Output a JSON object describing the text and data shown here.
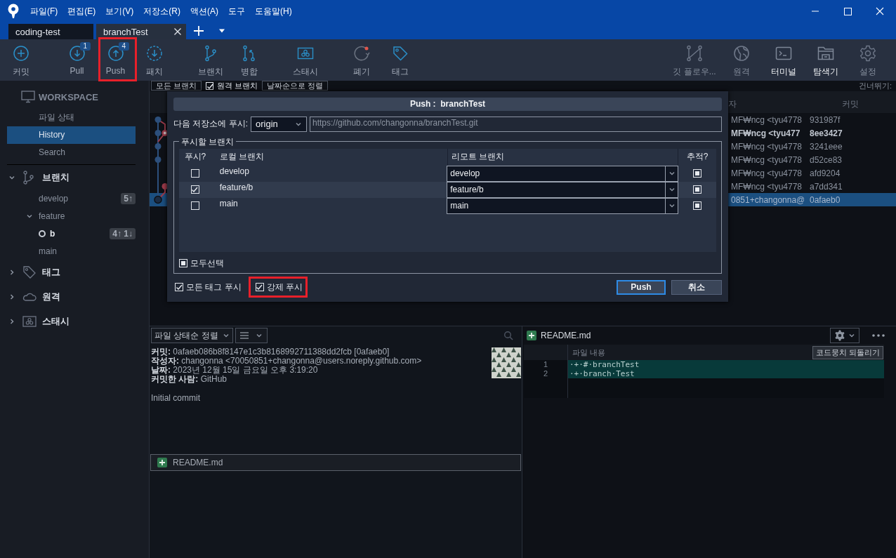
{
  "window": {
    "menu": [
      "파일(F)",
      "편집(E)",
      "보기(V)",
      "저장소(R)",
      "액션(A)",
      "도구",
      "도움말(H)"
    ]
  },
  "tabs": [
    {
      "label": "coding-test",
      "selected": false
    },
    {
      "label": "branchTest",
      "selected": true
    }
  ],
  "toolbar": {
    "left_groups": [
      [
        {
          "label": "커밋",
          "highlighted": false
        }
      ],
      [
        {
          "label": "Pull",
          "badge": "1",
          "highlighted": false
        },
        {
          "label": "Push",
          "badge": "4",
          "highlighted": true
        },
        {
          "label": "패치",
          "highlighted": false
        }
      ],
      [
        {
          "label": "브랜치",
          "highlighted": false
        },
        {
          "label": "병합",
          "highlighted": false
        }
      ],
      [
        {
          "label": "스태시",
          "highlighted": false
        }
      ],
      [
        {
          "label": "폐기",
          "highlighted": false
        },
        {
          "label": "태그",
          "highlighted": false
        }
      ]
    ],
    "right": [
      {
        "label": "깃 플로우...",
        "active": false
      },
      {
        "label": "원격",
        "active": false
      },
      {
        "label": "터미널",
        "active": true
      },
      {
        "label": "탐색기",
        "active": true
      },
      {
        "label": "설정",
        "active": false
      }
    ]
  },
  "sidebar": {
    "workspace": {
      "title": "WORKSPACE",
      "items": [
        {
          "label": "파일 상태",
          "selected": false
        },
        {
          "label": "History",
          "selected": true
        },
        {
          "label": "Search",
          "selected": false
        }
      ]
    },
    "sections": [
      {
        "title": "브랜치",
        "expanded": true,
        "children": [
          {
            "label": "develop",
            "badge": "5↑",
            "current": false
          },
          {
            "label": "feature",
            "expanded": true,
            "current": false,
            "children": [
              {
                "label": "b",
                "badge": "4↑ 1↓",
                "current": true
              }
            ]
          },
          {
            "label": "main",
            "current": false
          }
        ]
      },
      {
        "title": "태그",
        "expanded": false
      },
      {
        "title": "원격",
        "expanded": false
      },
      {
        "title": "스태시",
        "expanded": false
      }
    ]
  },
  "history": {
    "filters": {
      "branches": "모든 브랜치",
      "remote_branches": {
        "label": "원격 브랜치",
        "checked": true
      },
      "sort": "날짜순으로 정렬",
      "jump_label": "건너뛰기:"
    },
    "columns": [
      "자",
      "커밋"
    ],
    "rows": [
      {
        "author": "MF₩ncg <tyu4778",
        "commit": "931987f",
        "bold": false,
        "selected": false
      },
      {
        "author": "MF₩ncg <tyu477",
        "commit": "8ee3427",
        "bold": true,
        "selected": false
      },
      {
        "author": "MF₩ncg <tyu4778",
        "commit": "3241eee",
        "bold": false,
        "selected": false
      },
      {
        "author": "MF₩ncg <tyu4778",
        "commit": "d52ce83",
        "bold": false,
        "selected": false
      },
      {
        "author": "MF₩ncg <tyu4778",
        "commit": "afd9204",
        "bold": false,
        "selected": false
      },
      {
        "author": "MF₩ncg <tyu4778",
        "commit": "a7dd341",
        "bold": false,
        "selected": false
      },
      {
        "author": "0851+changonna@",
        "commit": "0afaeb0",
        "bold": false,
        "selected": true
      }
    ]
  },
  "push_dialog": {
    "title": "Push :  branchTest",
    "remote_label": "다음 저장소에 푸시:",
    "remote": "origin",
    "url": "https://github.com/changonna/branchTest.git",
    "group_title": "푸시할 브랜치",
    "columns": [
      "푸시?",
      "로컬 브랜치",
      "리모트 브랜치",
      "추적?"
    ],
    "branches": [
      {
        "push": false,
        "local": "develop",
        "remote": "develop",
        "track": true
      },
      {
        "push": true,
        "local": "feature/b",
        "remote": "feature/b",
        "track": true
      },
      {
        "push": false,
        "local": "main",
        "remote": "main",
        "track": true
      }
    ],
    "select_all": {
      "label": "모두선택",
      "indeterminate": true
    },
    "options": [
      {
        "label": "모든 태그 푸시",
        "checked": true,
        "highlighted": false
      },
      {
        "label": "강제 푸시",
        "checked": true,
        "highlighted": true
      }
    ],
    "buttons": [
      {
        "label": "Push",
        "default": true
      },
      {
        "label": "취소",
        "default": false
      }
    ]
  },
  "commit_details": {
    "sort": "파일 상태순 정렬",
    "lines": [
      "**커밋:** 0afaeb086b8f8147e1c3b8168992711388dd2fcb [0afaeb0]",
      "**작성자:** changonna <70050851+changonna@users.noreply.github.com>",
      "**날짜:** 2023년 12월 15일 금요일 오후 3:19:20",
      "**커밋한 사람:** GitHub"
    ],
    "message": "Initial commit",
    "files": [
      {
        "name": "README.md",
        "added": true
      }
    ]
  },
  "diff": {
    "file": {
      "name": "README.md",
      "added": true
    },
    "header": "파일 내용",
    "revert_button": "코드뭉치 되돌리기",
    "lines": [
      {
        "number": "1",
        "text": "·+·#·branchTest",
        "kind": "added"
      },
      {
        "number": "2",
        "text": "·+·branch·Test",
        "kind": "added"
      }
    ]
  }
}
